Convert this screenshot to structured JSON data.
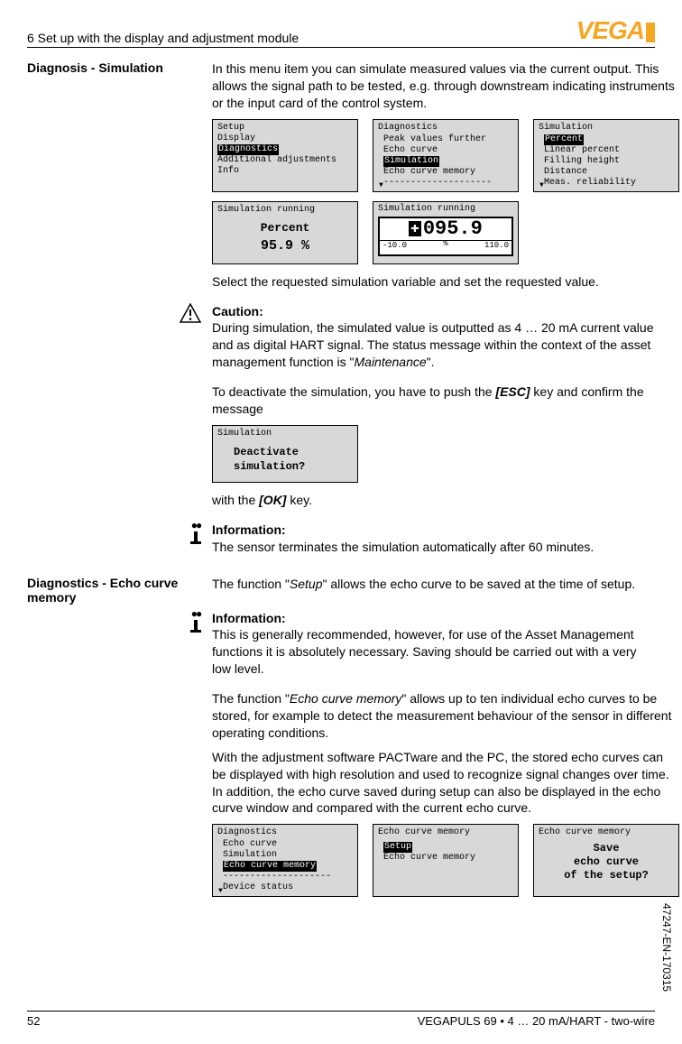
{
  "header": {
    "section_title": "6 Set up with the display and adjustment module",
    "logo_text": "VEGA"
  },
  "section1": {
    "heading": "Diagnosis - Simulation",
    "para1": "In this menu item you can simulate measured values via the current output. This allows the signal path to be tested, e.g. through downstream indicating instruments or the input card of the control system.",
    "lcd1": {
      "items": [
        "Setup",
        "Display",
        "Diagnostics",
        "Additional adjustments",
        "Info"
      ],
      "selected": 2
    },
    "lcd2": {
      "title": "Diagnostics",
      "items": [
        "Peak values further",
        "Echo curve",
        "Simulation",
        "Echo curve memory"
      ],
      "selected": 2
    },
    "lcd3": {
      "title": "Simulation",
      "items": [
        "Percent",
        "Linear percent",
        "Filling height",
        "Distance",
        "Meas. reliability"
      ],
      "selected": 0
    },
    "lcd4": {
      "title": "Simulation running",
      "label": "Percent",
      "value": "95.9 %"
    },
    "lcd5": {
      "title": "Simulation running",
      "meter_value": "095.9",
      "meter_unit": "%",
      "meter_min": "-10.0",
      "meter_max": "110.0"
    },
    "para2": "Select the requested simulation variable and set the requested value.",
    "caution_title": "Caution:",
    "caution_body_a": "During simulation, the simulated value is outputted as 4 … 20 mA current value and as digital HART signal. The status message within the context of the asset management function is \"",
    "caution_body_em": "Maintenance",
    "caution_body_b": "\".",
    "para3_a": "To deactivate the simulation, you have to push the ",
    "para3_key": "[ESC]",
    "para3_b": " key and confirm the message",
    "lcd6": {
      "title": "Simulation",
      "line1": "Deactivate",
      "line2": "simulation?"
    },
    "para4_a": "with the ",
    "para4_key": "[OK]",
    "para4_b": " key.",
    "info1_title": "Information:",
    "info1_body": "The sensor terminates the simulation automatically after 60 minutes."
  },
  "section2": {
    "heading": "Diagnostics - Echo curve memory",
    "para1_a": "The function \"",
    "para1_em": "Setup",
    "para1_b": "\" allows the echo curve to be saved at the time of setup.",
    "info2_title": "Information:",
    "info2_body": "This is generally recommended, however, for use of the Asset Management functions it is absolutely necessary. Saving should be carried out with a very low level.",
    "para2_a": "The function \"",
    "para2_em": "Echo curve memory",
    "para2_b": "\" allows up to ten individual echo curves to be stored, for example to detect the measurement behaviour of the sensor in different operating conditions.",
    "para3": "With the adjustment software PACTware and the PC, the stored echo curves can be displayed with high resolution and used to recognize signal changes over time. In addition, the echo curve saved during setup can also be displayed in the echo curve window and compared with the current echo curve.",
    "lcd7": {
      "title": "Diagnostics",
      "items": [
        "Echo curve",
        "Simulation",
        "Echo curve memory",
        "Device status"
      ],
      "selected": 2,
      "divider_after": 2
    },
    "lcd8": {
      "title": "Echo curve memory",
      "items": [
        "Setup",
        "Echo curve memory"
      ],
      "selected": 0
    },
    "lcd9": {
      "title": "Echo curve memory",
      "line1": "Save",
      "line2": "echo curve",
      "line3": "of the setup?"
    }
  },
  "side_text": "47247-EN-170315",
  "footer": {
    "page": "52",
    "product": "VEGAPULS 69 • 4 … 20 mA/HART - two-wire"
  }
}
